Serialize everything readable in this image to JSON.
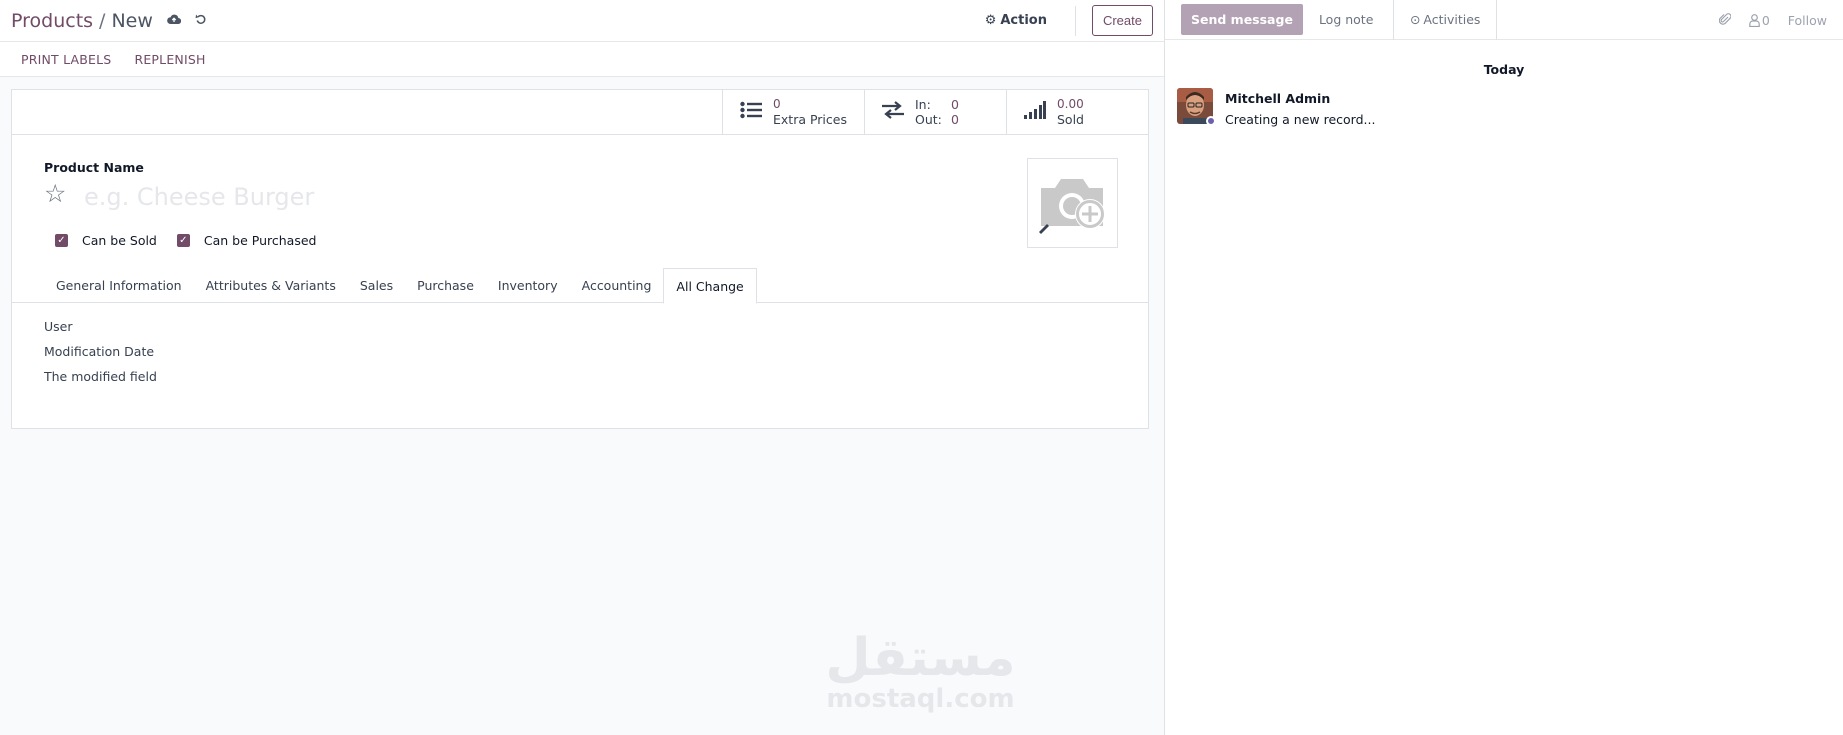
{
  "breadcrumb": {
    "parent": "Products",
    "separator": "/",
    "current": "New"
  },
  "control": {
    "action_label": "Action",
    "create_label": "Create"
  },
  "statusbar": {
    "print_labels": "PRINT LABELS",
    "replenish": "REPLENISH"
  },
  "smart_buttons": {
    "extra_prices": {
      "value": "0",
      "label": "Extra Prices"
    },
    "in_out": {
      "in_label": "In:",
      "in_value": "0",
      "out_label": "Out:",
      "out_value": "0"
    },
    "sold": {
      "value": "0.00",
      "label": "Sold"
    }
  },
  "form": {
    "product_name_label": "Product Name",
    "product_name_placeholder": "e.g. Cheese Burger",
    "can_be_sold": "Can be Sold",
    "can_be_purchased": "Can be Purchased"
  },
  "tabs": [
    {
      "label": "General Information",
      "active": false
    },
    {
      "label": "Attributes & Variants",
      "active": false
    },
    {
      "label": "Sales",
      "active": false
    },
    {
      "label": "Purchase",
      "active": false
    },
    {
      "label": "Inventory",
      "active": false
    },
    {
      "label": "Accounting",
      "active": false
    },
    {
      "label": "All Change",
      "active": true
    }
  ],
  "all_change_fields": [
    "User",
    "Modification Date",
    "The modified field"
  ],
  "watermark": {
    "arabic": "مستقل",
    "latin": "mostaql.com"
  },
  "chatter": {
    "send_message": "Send message",
    "log_note": "Log note",
    "activities": "Activities",
    "followers_count": "0",
    "follow": "Follow",
    "date_separator": "Today",
    "messages": [
      {
        "author": "Mitchell Admin",
        "body": "Creating a new record..."
      }
    ]
  },
  "colors": {
    "brand": "#714b67",
    "send_button": "#b3a1b4",
    "presence": "#6b60b0"
  }
}
